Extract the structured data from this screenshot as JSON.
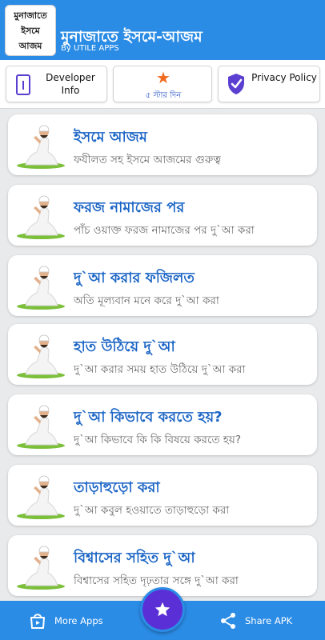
{
  "header": {
    "logo_lines": [
      "মুনাজাতে",
      "ইসমে",
      "আজম"
    ],
    "title": "মুনাজাতে ইসমে-আজম",
    "subtitle": "By UTILE APPS"
  },
  "topbar": {
    "developer_label": "Developer Info",
    "rate_label": "৫ স্টার দিন",
    "privacy_label": "Privacy Policy"
  },
  "items": [
    {
      "title": "ইসমে আজম",
      "subtitle": "ফযীলত সহ ইসমে আজমের গুরুত্ব"
    },
    {
      "title": "ফরজ নামাজের পর",
      "subtitle": "পাঁচ ওয়াক্ত ফরজ নামাজের পর দু`আ করা"
    },
    {
      "title": "দু`আ করার ফজিলত",
      "subtitle": "অতি মূল্যবান মনে করে দু`আ করা"
    },
    {
      "title": "হাত উঠিয়ে দু`আ",
      "subtitle": "দু`আ করার সময় হাত উঠিয়ে দু`আ করা"
    },
    {
      "title": "দু`আ কিভাবে করতে হয়?",
      "subtitle": "দু`আ কিভাবে কি কি বিষয়ে করতে হয়?"
    },
    {
      "title": "তাড়াহুড়ো করা",
      "subtitle": "দু`আ কবুল হওয়াতে তাড়াহুড়ো করা"
    },
    {
      "title": "বিশ্বাসের সহিত দু`আ",
      "subtitle": "বিশ্বাসের সহিত দৃঢ়তার সঙ্গে দু`আ করা"
    }
  ],
  "bottom": {
    "more_apps_label": "More Apps",
    "share_label": "Share APK"
  },
  "icons": {
    "developer": "info-icon",
    "rate": "star-icon",
    "privacy": "shield-check-icon",
    "item": "praying-man-icon",
    "more_apps": "app-store-icon",
    "share": "share-icon",
    "fab": "star-icon"
  },
  "colors": {
    "primary": "#2b8ce6",
    "fab": "#5b2fd6",
    "item_title": "#1d66c6",
    "rate_star": "#f06a1d"
  }
}
